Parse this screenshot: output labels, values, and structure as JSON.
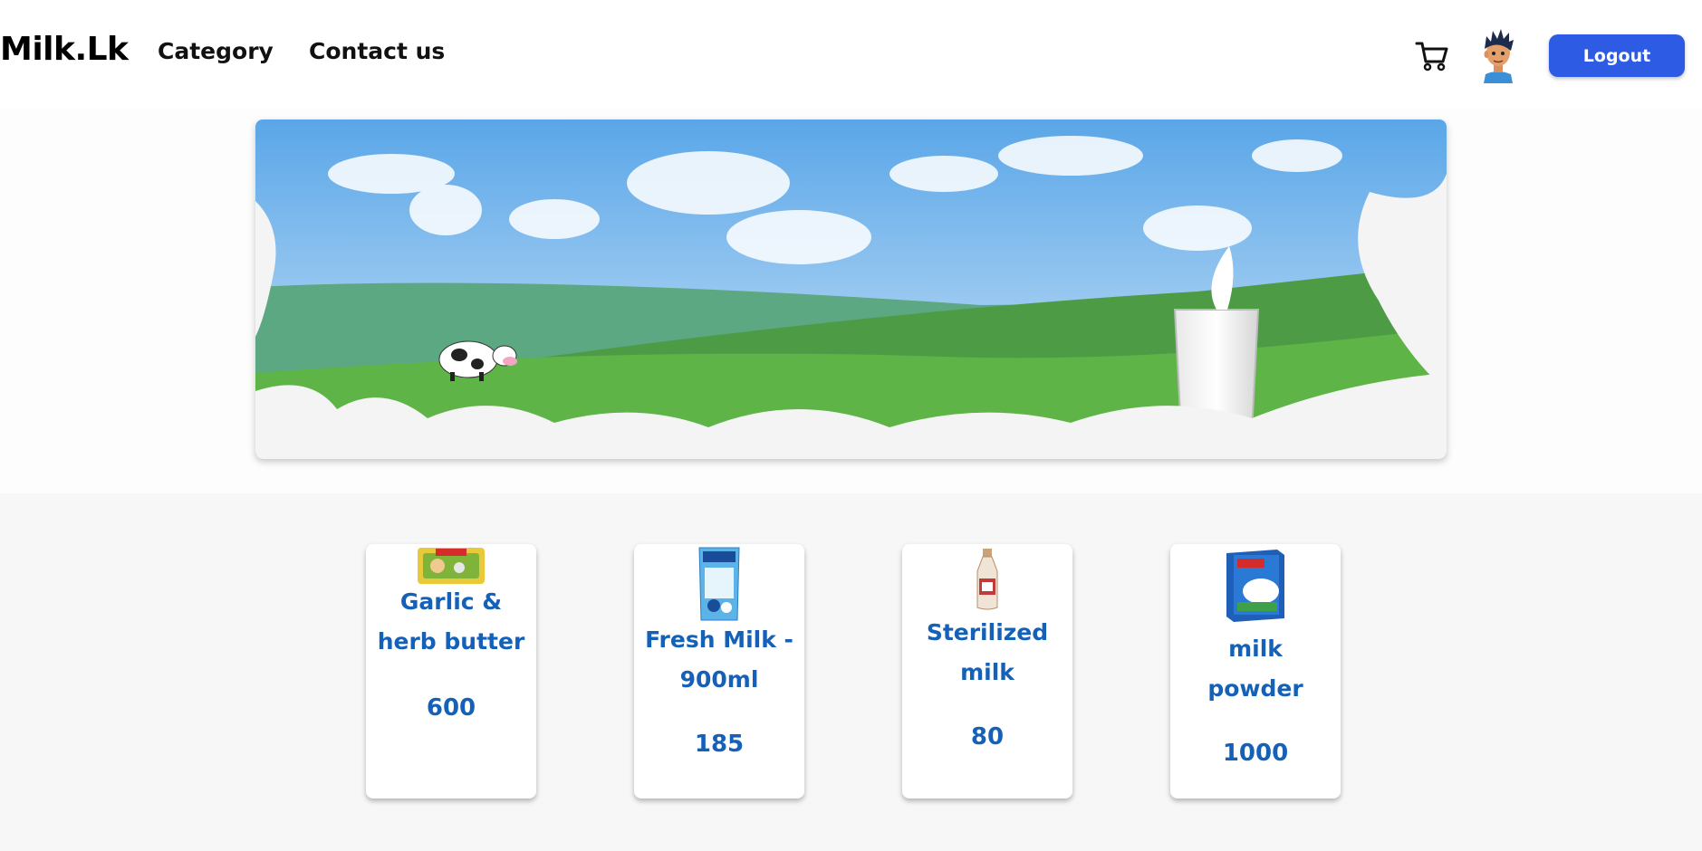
{
  "header": {
    "brand": "Milk.Lk",
    "nav": [
      {
        "label": "Category"
      },
      {
        "label": "Contact us"
      }
    ],
    "icons": {
      "cart": "cart-icon",
      "avatar": "user-avatar"
    },
    "logout_label": "Logout"
  },
  "banner": {
    "image": "farm-milk-splash-banner"
  },
  "products": [
    {
      "name": "Garlic & herb butter",
      "price": "600",
      "image": "butter-pack"
    },
    {
      "name": "Fresh Milk - 900ml",
      "price": "185",
      "image": "milk-pouch"
    },
    {
      "name": "Sterilized milk",
      "price": "80",
      "image": "milk-bottle"
    },
    {
      "name": "milk powder",
      "price": "1000",
      "image": "milk-powder-box"
    }
  ],
  "colors": {
    "accent": "#2d5be3",
    "product_text": "#1661b8",
    "page_bg": "#f7f7f7"
  }
}
